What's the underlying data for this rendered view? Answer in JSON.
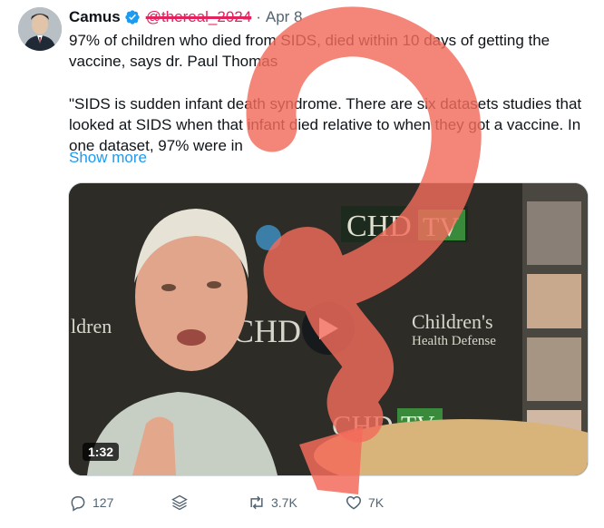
{
  "tweet": {
    "author_name": "Camus",
    "handle": "@thereal_2024",
    "separator": "·",
    "date": "Apr 8",
    "line1": "97% of children who died from SIDS, died within 10 days of getting the vaccine, says dr. Paul Thomas",
    "quote": "\"SIDS is sudden infant death syndrome. There are six datasets studies that looked at SIDS when that infant died relative to when they got a vaccine. In one dataset, 97% were in",
    "show_more": "Show more"
  },
  "media": {
    "duration": "1:32",
    "banner_texts": [
      "CHD",
      "TV",
      "CHD",
      "Children's",
      "Health Defense",
      "ldren",
      "CHD",
      "TV"
    ]
  },
  "actions": {
    "replies": "127",
    "reposts": "3.7K",
    "likes": "7K"
  },
  "colors": {
    "accent": "#1d9bf0",
    "overlay_red": "#f26b5b",
    "chd_green": "#2f8f3a"
  },
  "icons": [
    "verified-badge-icon",
    "play-icon",
    "reply-icon",
    "stack-icon",
    "repost-icon",
    "like-icon"
  ]
}
